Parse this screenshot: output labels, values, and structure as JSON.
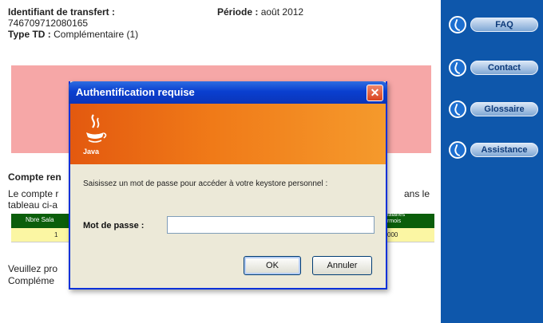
{
  "page": {
    "transfer_id_label": "Identifiant de transfert :",
    "transfer_id_value": "746709712080165",
    "type_label": "Type TD :",
    "type_value": "Complémentaire (1)",
    "period_label": "Période :",
    "period_value": "août 2012",
    "section_title": "Compte ren",
    "section_text_1": "Le compte r",
    "section_text_2": "tableau ci-a",
    "section_text_right": "ans le",
    "table_header_1": "Nbre Sala",
    "table_header_2": "ialaires\nrmois",
    "table_cell_1": "1",
    "table_cell_2": "000",
    "bottom_text_1": "Veuillez pro",
    "bottom_text_2": "Compléme"
  },
  "sidebar": {
    "items": [
      {
        "label": "FAQ",
        "icon": "refresh-circle-icon"
      },
      {
        "label": "Contact",
        "icon": "refresh-circle-icon"
      },
      {
        "label": "Glossaire",
        "icon": "refresh-circle-icon"
      },
      {
        "label": "Assistance",
        "icon": "refresh-circle-icon"
      }
    ]
  },
  "dialog": {
    "title": "Authentification requise",
    "close_symbol": "✕",
    "brand": "Java",
    "prompt": "Saisissez un mot de passe pour accéder à votre keystore personnel :",
    "password_label": "Mot de passe :",
    "password_value": "",
    "ok_label": "OK",
    "cancel_label": "Annuler"
  },
  "colors": {
    "sidebar_bg": "#0e57ab",
    "banner_pink": "#f6a7a7",
    "java_orange": "#f07a18",
    "titlebar_blue": "#0a3fd0",
    "table_green": "#0b5e0b",
    "table_row_yellow": "#fbf6a3"
  }
}
